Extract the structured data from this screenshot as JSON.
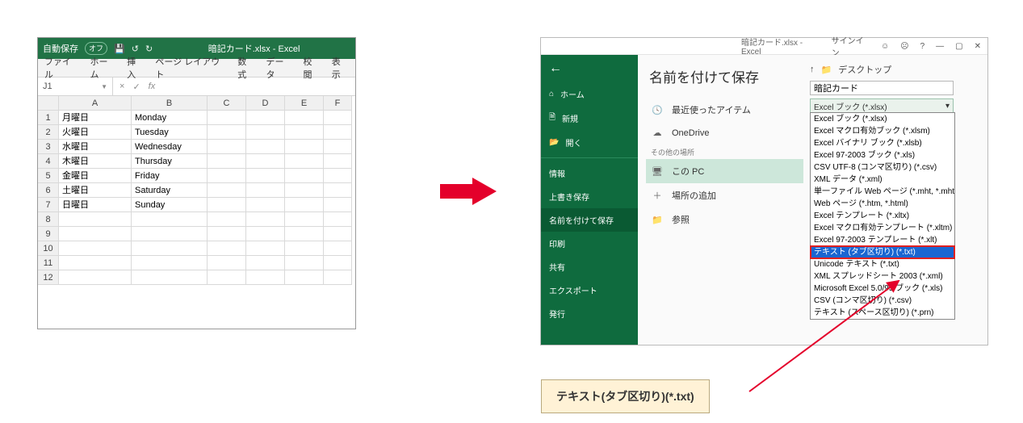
{
  "excel": {
    "autosave_label": "自動保存",
    "autosave_state": "オフ",
    "title": "暗記カード.xlsx - Excel",
    "menus": [
      "ファイル",
      "ホーム",
      "挿入",
      "ページ レイアウト",
      "数式",
      "データ",
      "校閲",
      "表示"
    ],
    "namebox": "J1",
    "columns": [
      "A",
      "B",
      "C",
      "D",
      "E",
      "F"
    ],
    "row_numbers": [
      "1",
      "2",
      "3",
      "4",
      "5",
      "6",
      "7",
      "8",
      "9",
      "10",
      "11",
      "12"
    ],
    "rows": [
      [
        "月曜日",
        "Monday",
        "",
        "",
        "",
        ""
      ],
      [
        "火曜日",
        "Tuesday",
        "",
        "",
        "",
        ""
      ],
      [
        "水曜日",
        "Wednesday",
        "",
        "",
        "",
        ""
      ],
      [
        "木曜日",
        "Thursday",
        "",
        "",
        "",
        ""
      ],
      [
        "金曜日",
        "Friday",
        "",
        "",
        "",
        ""
      ],
      [
        "土曜日",
        "Saturday",
        "",
        "",
        "",
        ""
      ],
      [
        "日曜日",
        "Sunday",
        "",
        "",
        "",
        ""
      ],
      [
        "",
        "",
        "",
        "",
        "",
        ""
      ],
      [
        "",
        "",
        "",
        "",
        "",
        ""
      ],
      [
        "",
        "",
        "",
        "",
        "",
        ""
      ],
      [
        "",
        "",
        "",
        "",
        "",
        ""
      ],
      [
        "",
        "",
        "",
        "",
        "",
        ""
      ]
    ]
  },
  "saveas": {
    "top_file": "暗記カード.xlsx - Excel",
    "signin": "サインイン",
    "help": "?",
    "heading": "名前を付けて保存",
    "side": {
      "home": "ホーム",
      "new": "新規",
      "open": "開く",
      "info": "情報",
      "save": "上書き保存",
      "saveas": "名前を付けて保存",
      "print": "印刷",
      "share": "共有",
      "export": "エクスポート",
      "publish": "発行"
    },
    "locations": {
      "recent": "最近使ったアイテム",
      "onedrive": "OneDrive",
      "other_header": "その他の場所",
      "thispc": "この PC",
      "addplace": "場所の追加",
      "browse": "参照"
    },
    "folder_up": "↑",
    "folder_label": "デスクトップ",
    "filename": "暗記カード",
    "combo_selected": "Excel ブック (*.xlsx)",
    "combo_arrow": "▾",
    "options": [
      "Excel ブック (*.xlsx)",
      "Excel マクロ有効ブック (*.xlsm)",
      "Excel バイナリ ブック (*.xlsb)",
      "Excel 97-2003 ブック (*.xls)",
      "CSV UTF-8 (コンマ区切り) (*.csv)",
      "XML データ (*.xml)",
      "単一ファイル Web ページ (*.mht, *.mhtml)",
      "Web ページ (*.htm, *.html)",
      "Excel テンプレート (*.xltx)",
      "Excel マクロ有効テンプレート (*.xltm)",
      "Excel 97-2003 テンプレート (*.xlt)",
      "テキスト (タブ区切り) (*.txt)",
      "Unicode テキスト (*.txt)",
      "XML スプレッドシート 2003 (*.xml)",
      "Microsoft Excel 5.0/95 ブック (*.xls)",
      "CSV (コンマ区切り) (*.csv)",
      "テキスト (スペース区切り) (*.prn)"
    ],
    "highlight_index": 11
  },
  "callout": "テキスト(タブ区切り)(*.txt)"
}
